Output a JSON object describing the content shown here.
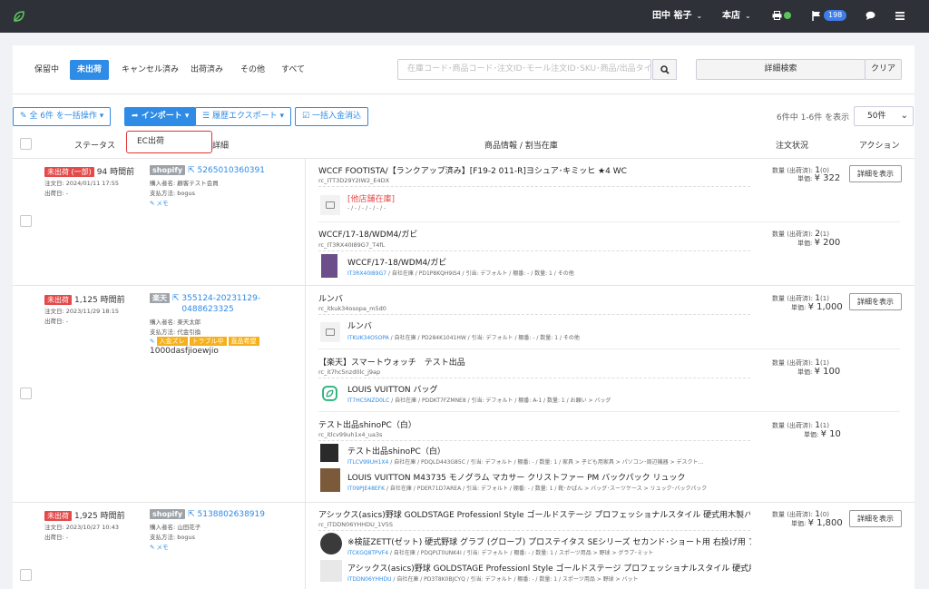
{
  "topbar": {
    "user": "田中 裕子",
    "store": "本店",
    "notify_count": "198"
  },
  "tabs": [
    "保留中",
    "未出荷",
    "キャンセル済み",
    "出荷済み",
    "その他",
    "すべて"
  ],
  "search": {
    "placeholder": "在庫コード･商品コード･注文ID･モール注文ID･SKU･商品/出品タイトル",
    "advanced": "詳細検索",
    "clear": "クリア"
  },
  "toolbar": {
    "bulk": "全 6件 を一括操作",
    "import": "インポート",
    "export": "履歴エクスポート",
    "payment": "一括入金消込",
    "count": "6件中 1-6件 を表示",
    "per_page": "50件"
  },
  "dropdown": {
    "item": "EC出荷"
  },
  "headers": {
    "status": "ステータス",
    "detail": "詳細",
    "product": "商品情報 / 割当在庫",
    "order": "注文状況",
    "action": "アクション"
  },
  "orders": [
    {
      "status_badge": "未出荷 (一部)",
      "elapsed": "94 時間前",
      "order_date": "注文日: 2024/01/11 17:55",
      "ship_date": "出荷日: -",
      "mall": "shopify",
      "order_no": "5265010360391",
      "buyer": "購入者名: 顧客テスト会員",
      "payment": "支払方法: bogus",
      "memo": "メモ",
      "action": "詳細を表示",
      "lines": [
        {
          "title": "WCCF FOOTISTA/【ランクアップ済み】[F19-2 011-R]ヨシュア･キミッヒ ★4 WC",
          "code": "rc_ITT3D29Y2IW2_E4DX",
          "item_name": "[他店舗在庫]",
          "item_meta": "- / - / - / - / - / -",
          "qty_label": "数量 (出荷済):",
          "qty": "1",
          "qty_shipped": "(0)",
          "price_label": "単価:",
          "price": "¥ 322"
        },
        {
          "title": "WCCF/17-18/WDM4/ガビ",
          "code": "rc_IT3RX40I89G7_T4fL",
          "item_name": "WCCF/17-18/WDM4/ガビ",
          "item_code": "IT3RX40I89G7",
          "item_meta": " / 自社在庫 / PD1P8KQH9IS4 / 引当: デフォルト / 棚番: - / 数量: 1 / その他",
          "qty_label": "数量 (出荷済):",
          "qty": "2",
          "qty_shipped": "(1)",
          "price_label": "単価:",
          "price": "¥ 200"
        }
      ]
    },
    {
      "status_badge": "未出荷",
      "elapsed": "1,125 時間前",
      "order_date": "注文日: 2023/11/29 18:15",
      "ship_date": "出荷日: -",
      "mall": "楽天",
      "order_no": "355124-20231129-0488623325",
      "buyer": "購入者名: 楽天太郎",
      "payment": "支払方法: 代金引換",
      "tags": [
        "入金ズレ",
        "トラブル中",
        "直品希望"
      ],
      "extra": "1000dasfjioewjio",
      "action": "詳細を表示",
      "lines": [
        {
          "title": "ルンバ",
          "code": "rc_itkuk34osopa_m5d0",
          "item_name": "ルンバ",
          "item_code": "ITKUK34OSOPA",
          "item_meta": " / 自社在庫 / PD284K1041HW / 引当: デフォルト / 棚番: - / 数量: 1 / その他",
          "qty_label": "数量 (出荷済):",
          "qty": "1",
          "qty_shipped": "(1)",
          "price_label": "単価:",
          "price": "¥ 1,000"
        },
        {
          "title": "【楽天】スマートウォッチ　テスト出品",
          "code": "rc_it7hc5nzd0lc_j9ap",
          "item_name": "LOUIS VUITTON バッグ",
          "item_code": "IT7HC5NZD0LC",
          "item_meta": " / 自社在庫 / PDDKT7FZMNE8 / 引当: デフォルト / 棚番: A-1 / 数量: 1 / お願い > バッグ",
          "qty_label": "数量 (出荷済):",
          "qty": "1",
          "qty_shipped": "(1)",
          "price_label": "単価:",
          "price": "¥ 100"
        },
        {
          "title": "テスト出品shinoPC（白）",
          "code": "rc_itlcv99uh1x4_ua3s",
          "item_name": "テスト出品shinoPC（白）",
          "item_code": "ITLCV99UH1X4",
          "item_meta": " / 自社在庫 / PDQLD443G85C / 引当: デフォルト / 棚番: - / 数量: 1 / 家具 > 子ども用家具 > パソコン･周辺機器 > デスクト...",
          "item2_name": "LOUIS VUITTON M43735 モノグラム マカサー クリストファー PM バックパック リュック",
          "item2_code": "IT09PJE48EFK",
          "item2_meta": " / 自社在庫 / PDER71D7AREA / 引当: デフォルト / 棚番: - / 数量: 1 / 靴･かばん > バッグ･スーツケース > リュック･バックパック",
          "qty_label": "数量 (出荷済):",
          "qty": "1",
          "qty_shipped": "(1)",
          "price_label": "単価:",
          "price": "¥ 10"
        }
      ]
    },
    {
      "status_badge": "未出荷",
      "elapsed": "1,925 時間前",
      "order_date": "注文日: 2023/10/27 10:43",
      "ship_date": "出荷日: -",
      "mall": "shopify",
      "order_no": "5138802638919",
      "buyer": "購入者名: 山田花子",
      "payment": "支払方法: bogus",
      "memo": "メモ",
      "action": "詳細を表示",
      "lines": [
        {
          "title": "アシックス(asics)野球 GOLDSTAGE Professionl Style ゴールドステージ プロフェッショナルスタイル 硬式用木製バット BFJル...",
          "code": "rc_ITDDN06YHHDU_1V5S",
          "item_name": "※検証ZETT(ゼット) 硬式野球 グラブ (グローブ) プロステイタス SEシリーズ セカンド･ショート用 右投げ用 ブラック (19...",
          "item_code": "ITCKGQ8TPVF4",
          "item_meta": " / 自社在庫 / PDQPLT0UNK4I / 引当: デフォルト / 棚番: - / 数量: 1 / スポーツ用品 > 野球 > グラブ･ミット",
          "item2_name": "アシックス(asics)野球 GOLDSTAGE Professionl Style ゴールドステージ プロフェッショナルスタイル 硬式用木製バット...",
          "item2_code": "ITDDN06YHHDU",
          "item2_meta": " / 自社在庫 / PD3T8K0BJCYQ / 引当: デフォルト / 棚番: - / 数量: 1 / スポーツ用品 > 野球 > バット",
          "qty_label": "数量 (出荷済):",
          "qty": "1",
          "qty_shipped": "(0)",
          "price_label": "単価:",
          "price": "¥ 1,800"
        }
      ]
    }
  ]
}
